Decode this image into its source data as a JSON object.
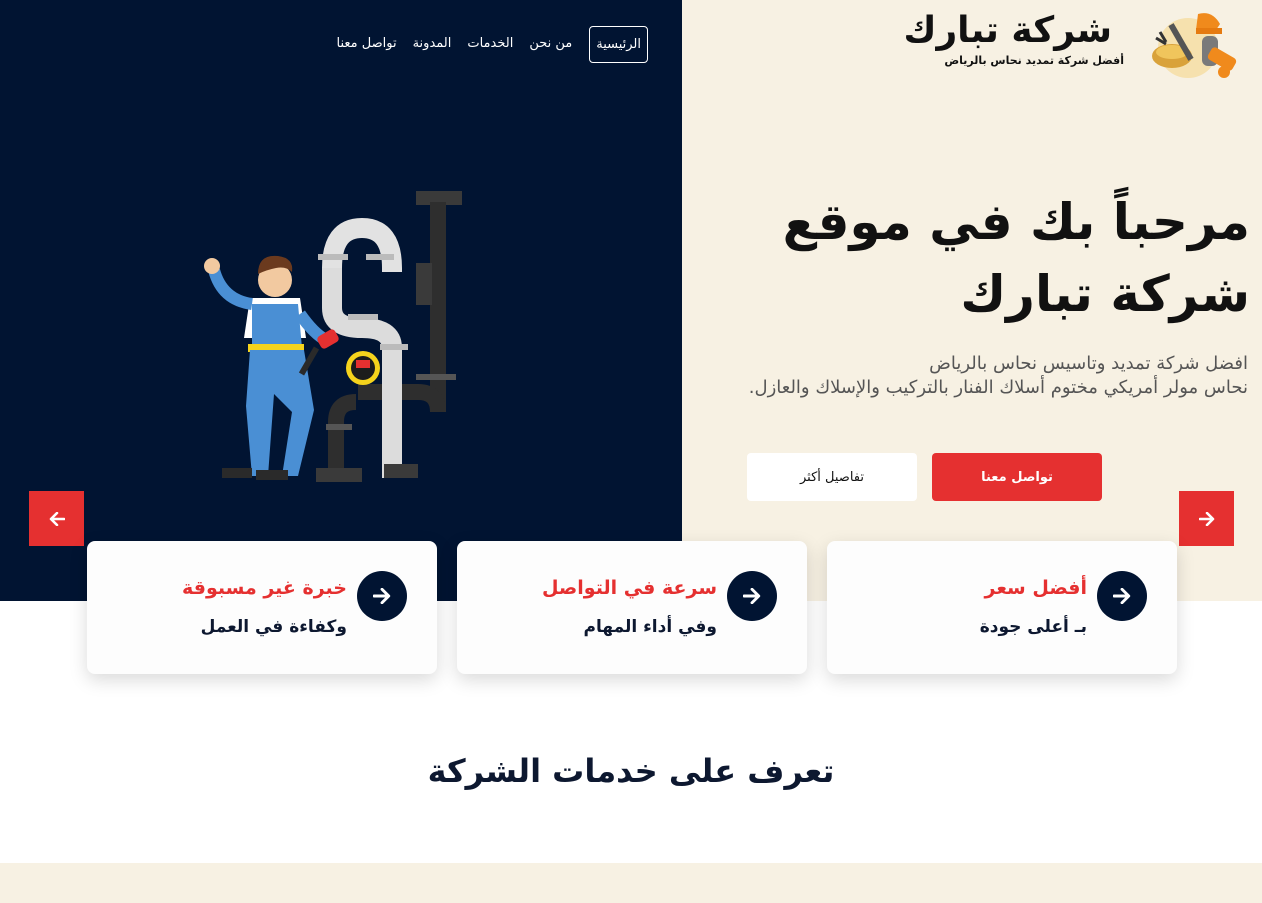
{
  "logo": {
    "title": "شركة تبارك",
    "subtitle": "أفضل شركة تمديد نحاس بالرياض"
  },
  "nav": {
    "items": [
      {
        "label": "الرئيسية"
      },
      {
        "label": "من نحن"
      },
      {
        "label": "الخدمات"
      },
      {
        "label": "المدونة"
      },
      {
        "label": "تواصل معنا"
      }
    ]
  },
  "hero": {
    "title": "مرحباً بك في موقع شركة تبارك",
    "desc_line1": "افضل شركة تمديد وتاسيس نحاس بالرياض",
    "desc_line2": "نحاس مولر أمريكي مختوم أسلاك الفنار بالتركيب والإسلاك والعازل.",
    "contact_button": "تواصل معنا",
    "details_button": "تفاصيل أكثر"
  },
  "features": [
    {
      "title": "أفضل سعر",
      "subtitle": "بـ أعلى جودة"
    },
    {
      "title": "سرعة في التواصل",
      "subtitle": "وفي أداء المهام"
    },
    {
      "title": "خبرة غير مسبوقة",
      "subtitle": "وكفاءة في العمل"
    }
  ],
  "services": {
    "title": "تعرف على خدمات الشركة"
  },
  "colors": {
    "navy": "#011432",
    "accent_red": "#e53030",
    "cream": "#f7f1e3"
  },
  "icons": {
    "arrow_prev": "arrow-left-icon",
    "arrow_next": "arrow-right-icon",
    "card_arrow": "arrow-right-icon"
  }
}
